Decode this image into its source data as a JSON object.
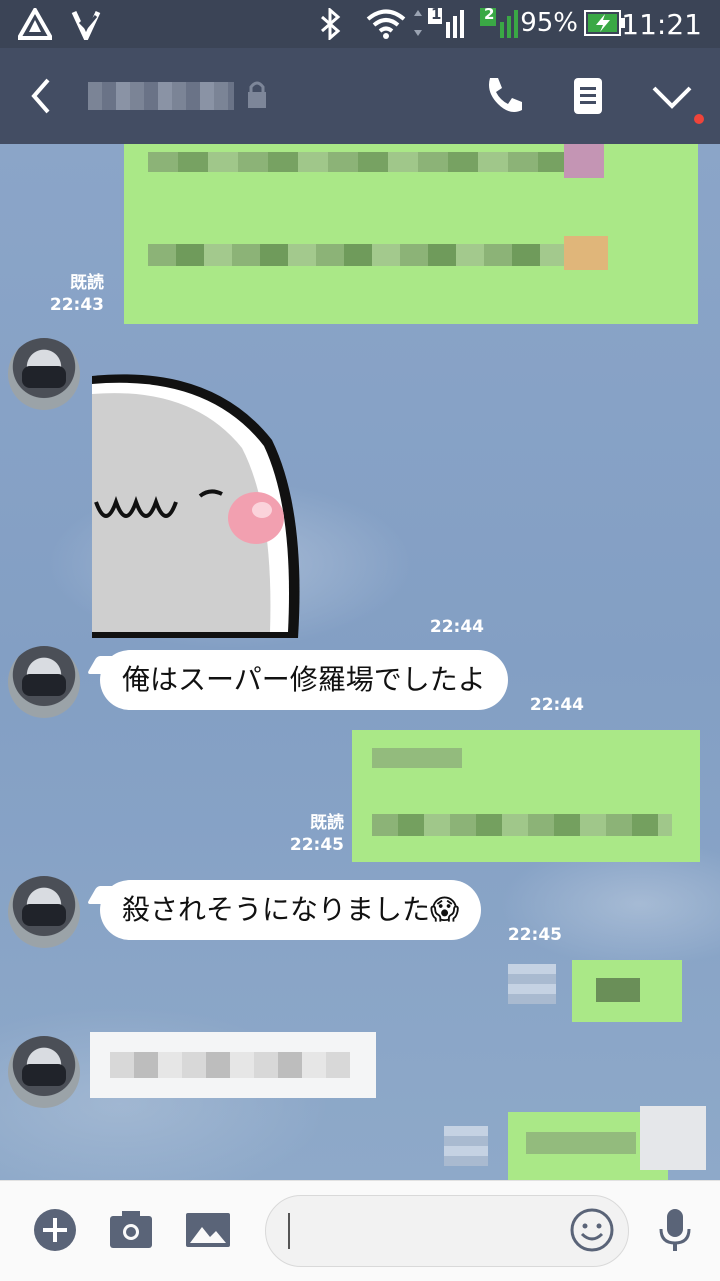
{
  "status_bar": {
    "time": "11:21",
    "battery_percent": "95%",
    "sim1_label": "1",
    "sim2_label": "2",
    "icons": [
      "alert-triangle-icon",
      "bell-check-icon",
      "bluetooth-icon",
      "wifi-icon",
      "signal-icon",
      "battery-charging-icon"
    ]
  },
  "header": {
    "icons": [
      "back-chevron-icon",
      "lock-icon",
      "phone-icon",
      "notes-icon",
      "chevron-down-icon"
    ],
    "notification_dot_color": "#f0443a"
  },
  "messages": {
    "m1": {
      "read": "既読",
      "time": "22:43"
    },
    "m2": {
      "time": "22:44"
    },
    "m3": {
      "text": "俺はスーパー修羅場でしたよ",
      "time": "22:44"
    },
    "m4": {
      "read": "既読",
      "time": "22:45"
    },
    "m5": {
      "text": "殺されそうになりました😱",
      "time": "22:45"
    }
  },
  "input_bar": {
    "icons": [
      "plus-icon",
      "camera-icon",
      "image-icon",
      "emoji-icon",
      "microphone-icon"
    ],
    "message_value": ""
  },
  "colors": {
    "outgoing_bubble": "#aae887",
    "incoming_bubble": "#ffffff",
    "header_bg": "#434d63",
    "statusbar_bg": "#3b4456"
  }
}
